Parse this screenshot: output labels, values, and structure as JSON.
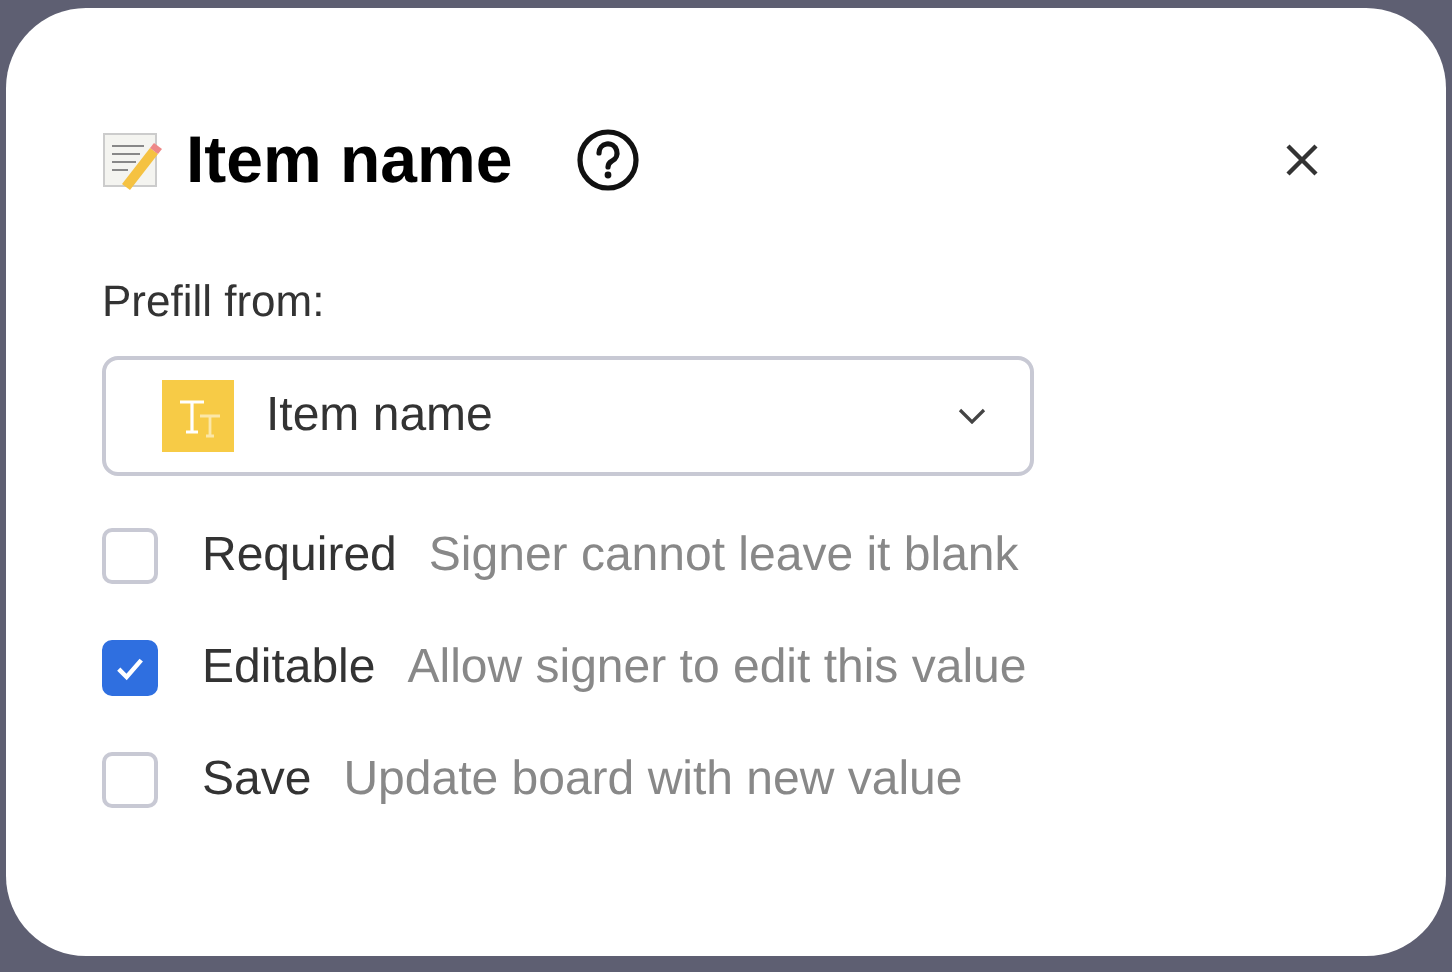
{
  "dialog": {
    "title": "Item name",
    "prefill_label": "Prefill from:",
    "prefill_value": "Item name",
    "options": [
      {
        "label": "Required",
        "hint": "Signer cannot leave it blank",
        "checked": false
      },
      {
        "label": "Editable",
        "hint": "Allow signer to edit this value",
        "checked": true
      },
      {
        "label": "Save",
        "hint": "Update board with new value",
        "checked": false
      }
    ]
  }
}
